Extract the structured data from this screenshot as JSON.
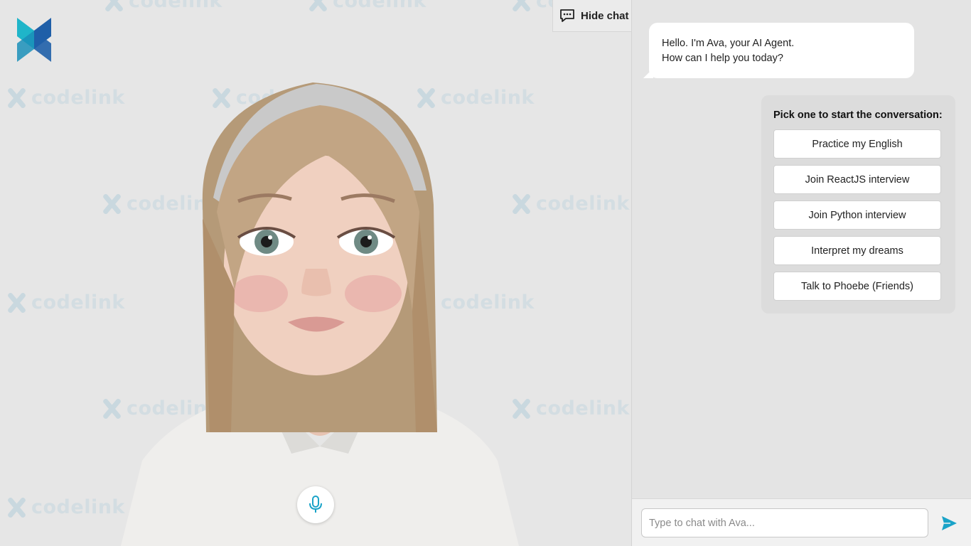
{
  "watermark": {
    "text": "codelink"
  },
  "header": {
    "hide_chat_label": "Hide chat"
  },
  "chat": {
    "bot_greeting_line1": "Hello. I'm Ava, your AI Agent.",
    "bot_greeting_line2": "How can I help you today?",
    "picker_title": "Pick one to start the conversation:",
    "options": [
      "Practice my English",
      "Join ReactJS interview",
      "Join Python interview",
      "Interpret my dreams",
      "Talk to Phoebe (Friends)"
    ],
    "input_placeholder": "Type to chat with Ava..."
  },
  "colors": {
    "accent": "#1aa3c8",
    "brand_dark": "#1f5fa8",
    "brand_light": "#1fb5c9"
  },
  "icons": {
    "chat": "chat-bubble-icon",
    "mic": "microphone-icon",
    "send": "send-icon"
  }
}
